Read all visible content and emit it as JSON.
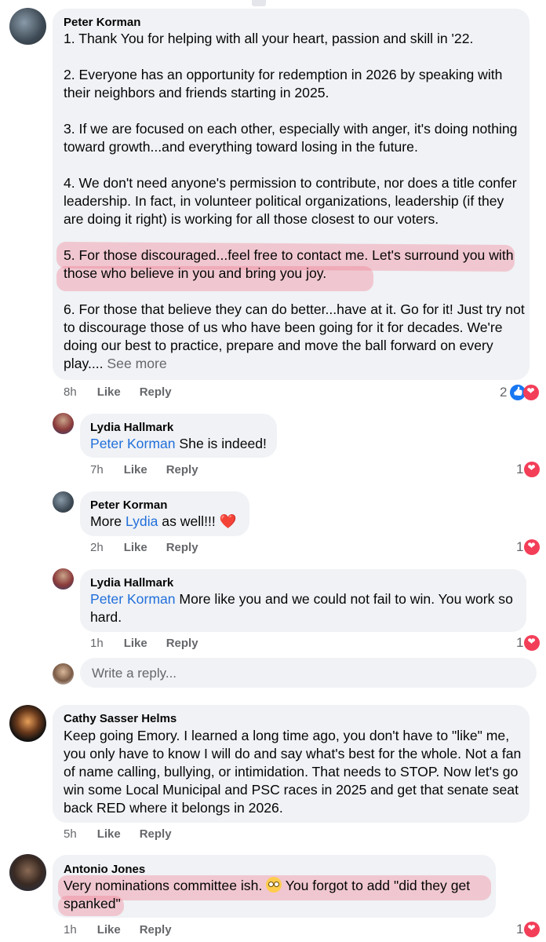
{
  "comments": [
    {
      "author": "Peter Korman",
      "paragraphs": [
        "1.  Thank You for helping with all your heart, passion and skill in '22.",
        "2.  Everyone has an opportunity for redemption in 2026 by speaking with their neighbors and friends starting in 2025.",
        "3.  If we are focused on each other, especially with anger, it's doing nothing toward growth...and everything toward losing in the future.",
        "4.  We don't need anyone's permission to contribute, nor does a title confer leadership.  In fact, in volunteer political organizations, leadership (if they are doing it right) is working for all those closest to our voters.",
        "5. For those discouraged...feel free to contact me.  Let's surround you with those who believe in you and bring you joy.",
        "6. For those that believe they can do better...have at it.  Go for it!  Just try not to discourage those of us who have been going for it for decades.  We're doing our best to practice, prepare and move the ball forward on every play...."
      ],
      "see_more": "See more",
      "time": "8h",
      "like": "Like",
      "reply": "Reply",
      "reactions": "2"
    },
    {
      "author": "Lydia Hallmark",
      "mention": "Peter Korman",
      "text": " She is indeed!",
      "time": "7h",
      "like": "Like",
      "reply": "Reply",
      "reactions": "1"
    },
    {
      "author": "Peter Korman",
      "pre": "More ",
      "mention": "Lydia",
      "text": " as well!!! ",
      "emoji": "❤️",
      "time": "2h",
      "like": "Like",
      "reply": "Reply",
      "reactions": "1"
    },
    {
      "author": "Lydia Hallmark",
      "mention": "Peter Korman",
      "text": " More like you and we could not fail to win. You work so hard.",
      "time": "1h",
      "like": "Like",
      "reply": "Reply",
      "reactions": "1"
    },
    {
      "author": "Cathy Sasser Helms",
      "text": "Keep going Emory.  I learned a long time ago, you don't have to \"like\" me, you only have to know I will do and say what's best for the whole.  Not a fan of name calling, bullying, or intimidation.  That needs to STOP.  Now let's go win some Local Municipal and PSC races in 2025 and get that senate seat back RED where it belongs in 2026.",
      "time": "5h",
      "like": "Like",
      "reply": "Reply"
    },
    {
      "author": "Antonio Jones",
      "text1": "Very nominations committee ish. ",
      "text2": " You forgot to add \"did they get spanked\"",
      "time": "1h",
      "like": "Like",
      "reply": "Reply",
      "reactions": "1"
    }
  ],
  "reply_box": {
    "placeholder": "Write a reply..."
  },
  "colors": {
    "bubble": "#f0f2f5",
    "link": "#216fdb",
    "highlight": "#f0788c",
    "like_blue": "#1877f2",
    "heart_red": "#f33e58"
  }
}
